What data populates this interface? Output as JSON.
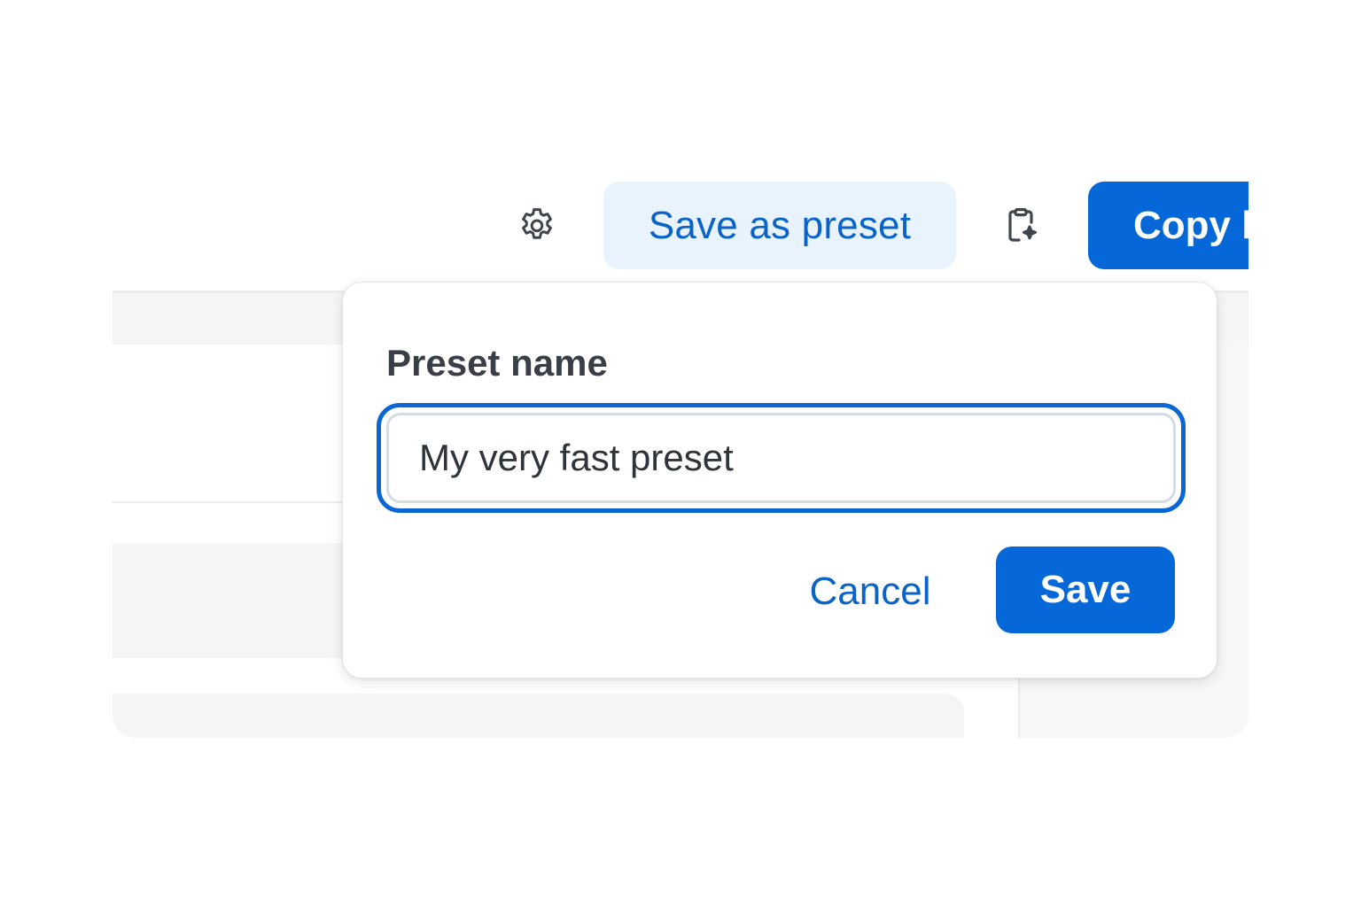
{
  "toolbar": {
    "settings_icon": "gear-icon",
    "save_as_preset_label": "Save as preset",
    "ai_clipboard_icon": "clipboard-sparkle-icon",
    "copy_label": "Copy l"
  },
  "popover": {
    "field_label": "Preset name",
    "input_value": "My very fast preset",
    "cancel_label": "Cancel",
    "save_label": "Save"
  },
  "colors": {
    "accent": "#0668d8",
    "accent_text": "#0a63c9",
    "accent_soft": "#e8f3fd",
    "focus_ring": "#0a66d4"
  }
}
